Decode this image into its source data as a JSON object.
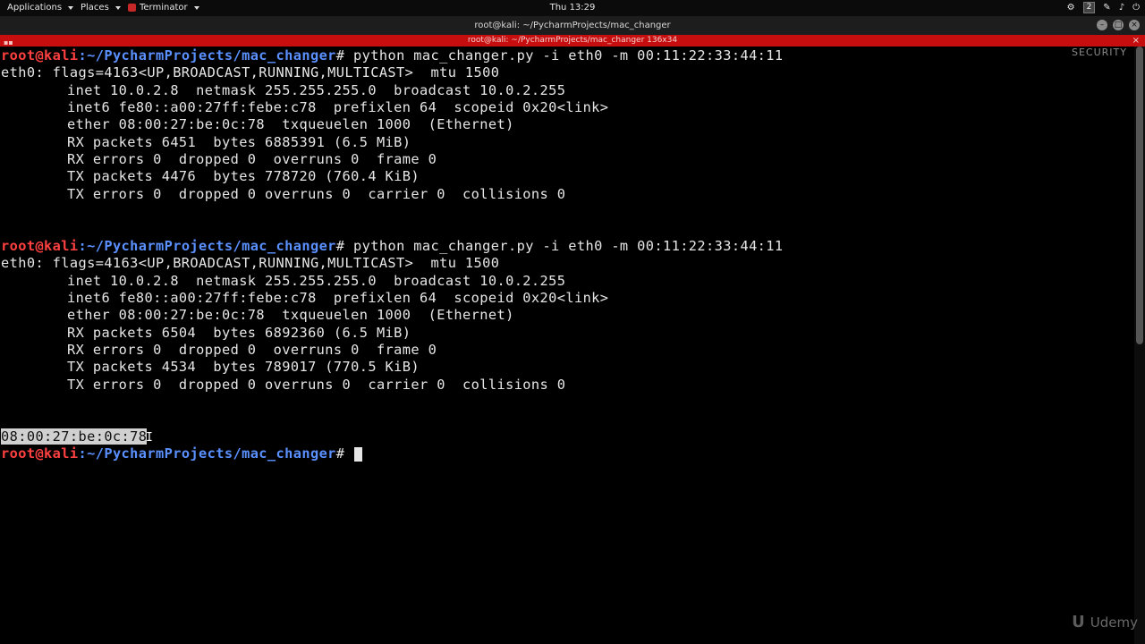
{
  "topbar": {
    "applications": "Applications",
    "places": "Places",
    "terminator": "Terminator",
    "clock": "Thu 13:29",
    "workspace": "2"
  },
  "window": {
    "title": "root@kali: ~/PycharmProjects/mac_changer",
    "tab_title": "root@kali: ~/PycharmProjects/mac_changer 136x34"
  },
  "terminal": {
    "prompt_user": "root@kali",
    "prompt_path": ":~/PycharmProjects/mac_changer",
    "prompt_symbol": "# ",
    "command": "python mac_changer.py -i eth0 -m 00:11:22:33:44:11",
    "block1": {
      "flags": "eth0: flags=4163<UP,BROADCAST,RUNNING,MULTICAST>  mtu 1500",
      "inet": "inet 10.0.2.8  netmask 255.255.255.0  broadcast 10.0.2.255",
      "inet6": "inet6 fe80::a00:27ff:febe:c78  prefixlen 64  scopeid 0x20<link>",
      "ether": "ether 08:00:27:be:0c:78  txqueuelen 1000  (Ethernet)",
      "rx_packets": "RX packets 6451  bytes 6885391 (6.5 MiB)",
      "rx_errors": "RX errors 0  dropped 0  overruns 0  frame 0",
      "tx_packets": "TX packets 4476  bytes 778720 (760.4 KiB)",
      "tx_errors": "TX errors 0  dropped 0 overruns 0  carrier 0  collisions 0"
    },
    "block2": {
      "flags": "eth0: flags=4163<UP,BROADCAST,RUNNING,MULTICAST>  mtu 1500",
      "inet": "inet 10.0.2.8  netmask 255.255.255.0  broadcast 10.0.2.255",
      "inet6": "inet6 fe80::a00:27ff:febe:c78  prefixlen 64  scopeid 0x20<link>",
      "ether": "ether 08:00:27:be:0c:78  txqueuelen 1000  (Ethernet)",
      "rx_packets": "RX packets 6504  bytes 6892360 (6.5 MiB)",
      "rx_errors": "RX errors 0  dropped 0  overruns 0  frame 0",
      "tx_packets": "TX packets 4534  bytes 789017 (770.5 KiB)",
      "tx_errors": "TX errors 0  dropped 0 overruns 0  carrier 0  collisions 0"
    },
    "selected_mac": "08:00:27:be:0c:78"
  },
  "watermarks": {
    "security": "SECURITY",
    "udemy": "Udemy"
  },
  "colors": {
    "tab_bar": "#c70e0e",
    "prompt_user": "#ff4040",
    "prompt_path": "#5a90ff"
  }
}
